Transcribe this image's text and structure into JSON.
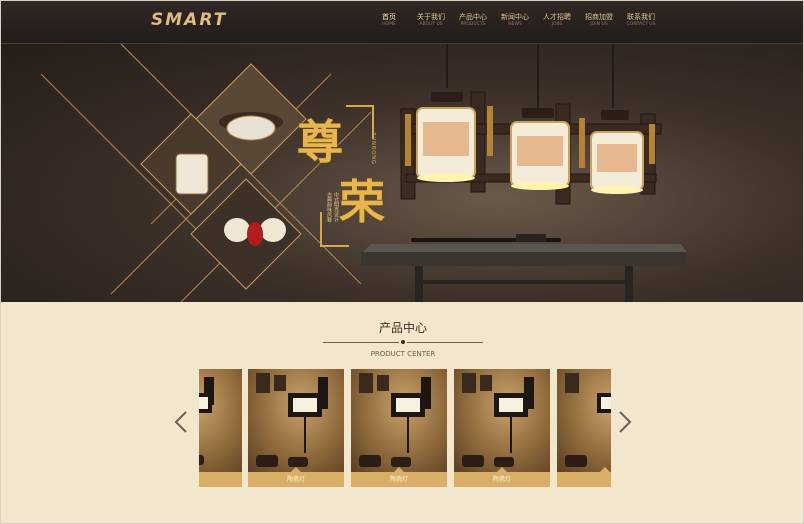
{
  "header": {
    "logo": "SMART",
    "nav": [
      {
        "zh": "首页",
        "en": "HOME"
      },
      {
        "zh": "关于我们",
        "en": "ABOUT US"
      },
      {
        "zh": "产品中心",
        "en": "PRODUCTS"
      },
      {
        "zh": "新闻中心",
        "en": "NEWS"
      },
      {
        "zh": "人才招聘",
        "en": "JOBS"
      },
      {
        "zh": "招商加盟",
        "en": "JOIN US"
      },
      {
        "zh": "联系我们",
        "en": "CONTACT US"
      }
    ]
  },
  "banner": {
    "title_char_1": "尊",
    "title_char_2": "荣",
    "title_en": "ZUNRONG",
    "subtitle_1": "中式明亮设计",
    "subtitle_2": "古典韵味风雅"
  },
  "products": {
    "title": "产品中心",
    "subtitle": "PRODUCT CENTER",
    "items": [
      {
        "label": ""
      },
      {
        "label": "陶瓷灯"
      },
      {
        "label": "陶瓷灯"
      },
      {
        "label": "陶瓷灯"
      },
      {
        "label": ""
      }
    ],
    "prev_icon": "chevron-left-icon",
    "next_icon": "chevron-right-icon"
  },
  "colors": {
    "header_bg": "#221c1a",
    "accent_gold": "#e2c48d",
    "section_bg": "#f2e6cc",
    "card_label_bg": "#d9ae66"
  }
}
